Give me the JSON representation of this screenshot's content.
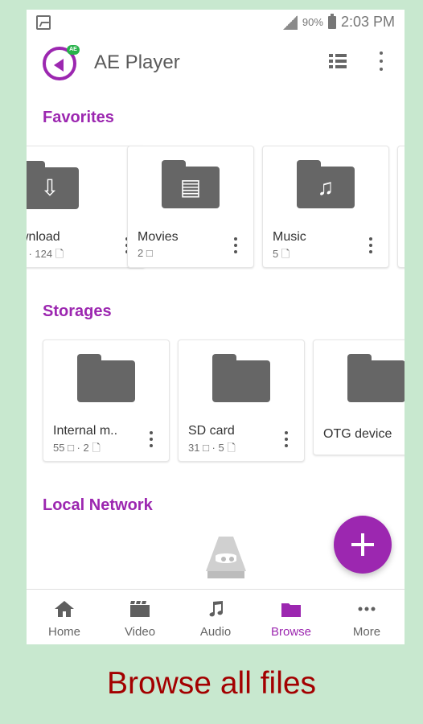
{
  "status_bar": {
    "battery_percent": "90%",
    "time": "2:03 PM"
  },
  "app": {
    "title": "AE Player",
    "logo_badge": "AE"
  },
  "sections": {
    "favorites": "Favorites",
    "storages": "Storages",
    "local_network": "Local Network"
  },
  "favorites": [
    {
      "label": "wnload",
      "sub": "□ · 124 🗋"
    },
    {
      "label": "Movies",
      "sub": "2 □"
    },
    {
      "label": "Music",
      "sub": "5 🗋"
    }
  ],
  "storages": [
    {
      "label": "Internal m..",
      "sub": "55 □ · 2 🗋"
    },
    {
      "label": "SD card",
      "sub": "31 □ · 5 🗋"
    },
    {
      "label": "OTG device",
      "sub": ""
    }
  ],
  "bottom_nav": [
    {
      "label": "Home"
    },
    {
      "label": "Video"
    },
    {
      "label": "Audio"
    },
    {
      "label": "Browse"
    },
    {
      "label": "More"
    }
  ],
  "caption": "Browse all files",
  "colors": {
    "accent": "#9c27b0",
    "background": "#c8e8cf",
    "caption": "#a30000"
  }
}
